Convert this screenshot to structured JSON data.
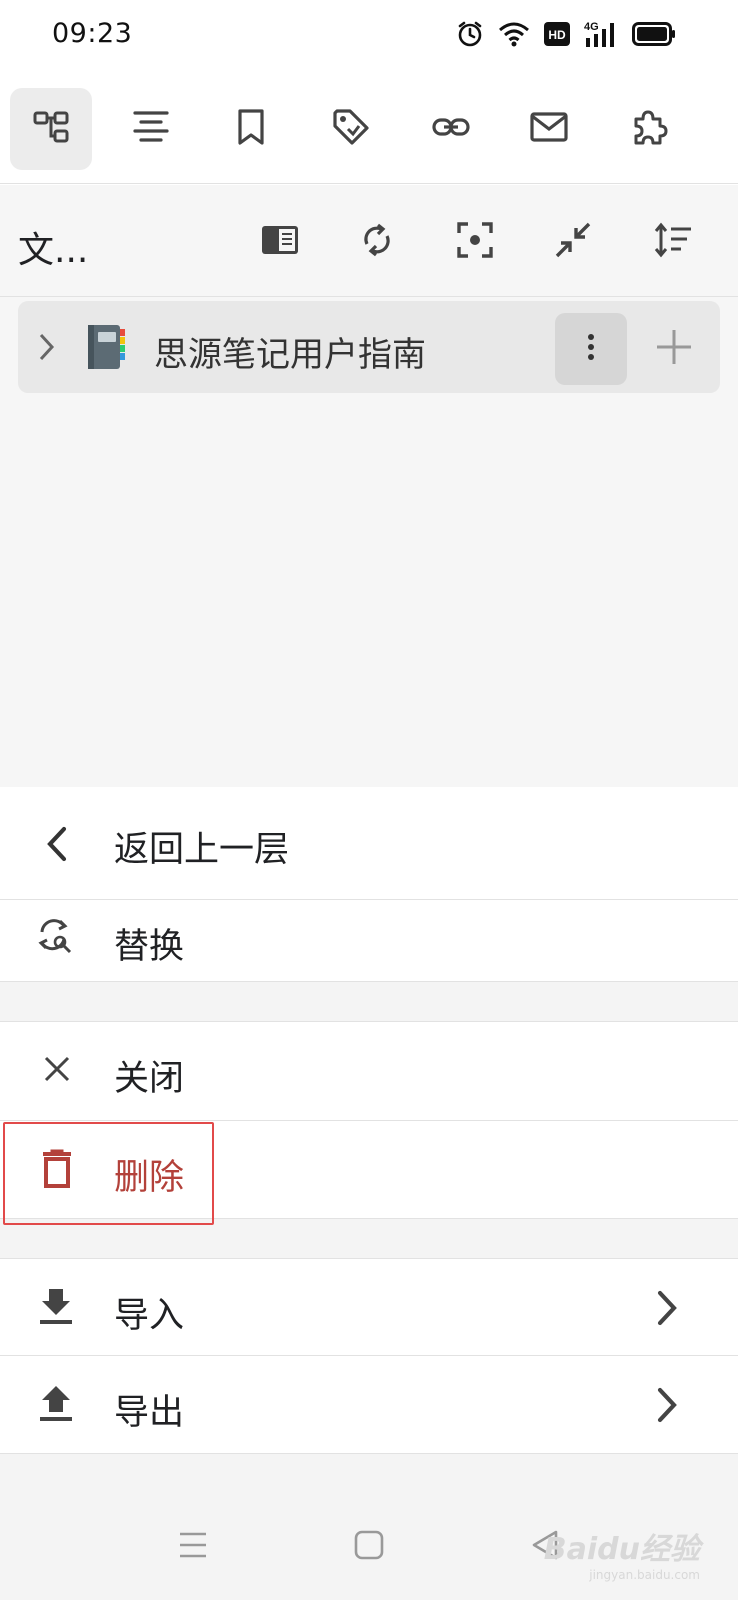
{
  "status": {
    "time": "09:23",
    "icons": [
      "alarm-icon",
      "wifi-icon",
      "hd-icon",
      "signal-4g-icon",
      "battery-icon"
    ],
    "hd_label": "HD",
    "network_label": "4G"
  },
  "dock": {
    "buttons": [
      {
        "name": "file-tree-icon",
        "active": true
      },
      {
        "name": "outline-icon",
        "active": false
      },
      {
        "name": "bookmark-icon",
        "active": false
      },
      {
        "name": "tag-icon",
        "active": false
      },
      {
        "name": "backlink-icon",
        "active": false
      },
      {
        "name": "inbox-icon",
        "active": false
      },
      {
        "name": "plugin-icon",
        "active": false
      }
    ]
  },
  "toolbar": {
    "title": "文...",
    "buttons": [
      "sidebar-toggle-icon",
      "refresh-icon",
      "focus-icon",
      "collapse-icon",
      "sort-icon"
    ]
  },
  "tree": {
    "items": [
      {
        "label": "思源笔记用户指南",
        "icon": "notebook-icon"
      }
    ]
  },
  "menu": {
    "back_label": "返回上一层",
    "replace_label": "替换",
    "close_label": "关闭",
    "delete_label": "删除",
    "import_label": "导入",
    "export_label": "导出"
  },
  "colors": {
    "accent_delete": "#b3413a",
    "highlight_box": "#e24a4a",
    "toolbar_bg": "#f6f6f6",
    "active_button_bg": "#ececec"
  },
  "navbar": {
    "buttons": [
      "menu-icon",
      "home-icon",
      "back-icon"
    ],
    "watermark": "Baidu经验",
    "watermark_sub": "jingyan.baidu.com"
  }
}
